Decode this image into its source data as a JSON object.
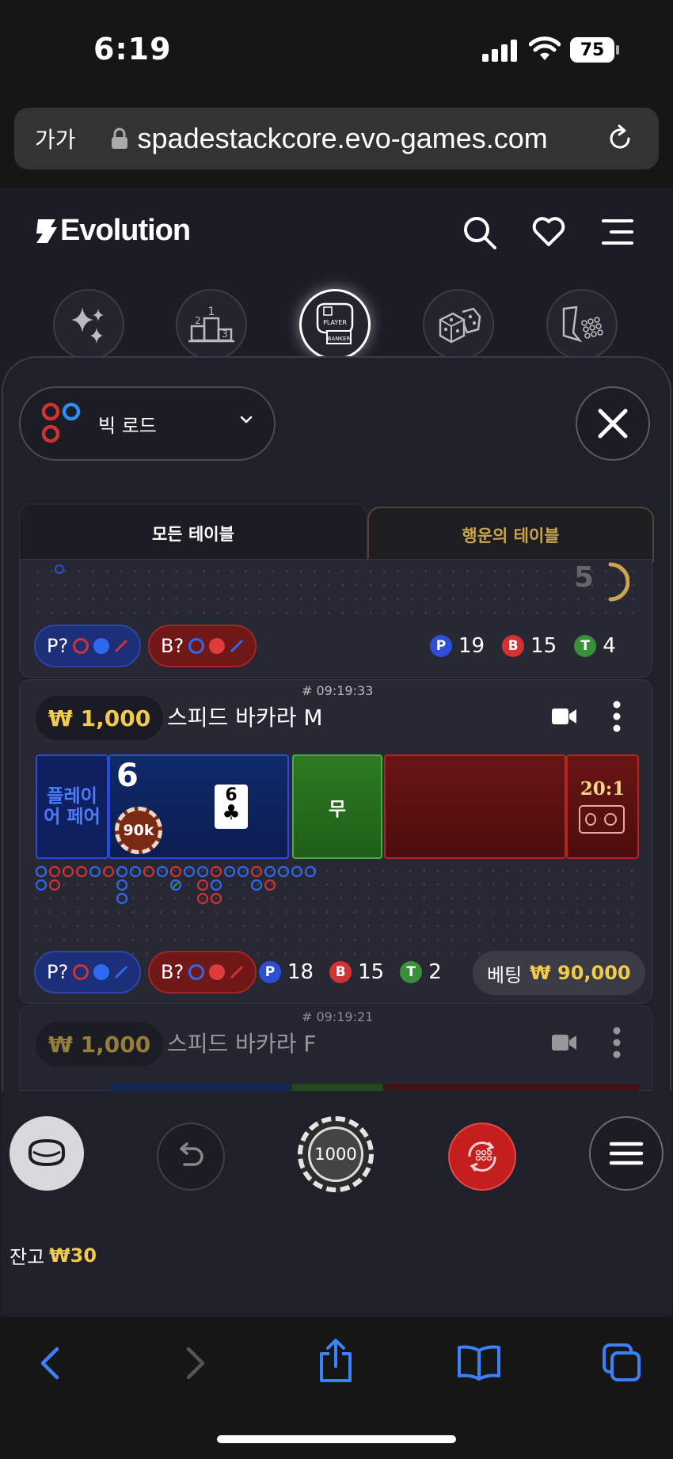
{
  "status_bar": {
    "time": "6:19",
    "battery": "75"
  },
  "browser": {
    "text_size_label": "가가",
    "url": "spadestackcore.evo-games.com"
  },
  "app": {
    "logo_text": "Evolution"
  },
  "categories": [
    {
      "icon": "sparkles-icon"
    },
    {
      "icon": "podium-icon",
      "podium": [
        "1",
        "2",
        "3"
      ]
    },
    {
      "icon": "baccarat-icon",
      "labels": [
        "PLAYER",
        "BANKER"
      ],
      "active": true
    },
    {
      "icon": "dice-icon"
    },
    {
      "icon": "roulette-icon"
    }
  ],
  "road_select": {
    "label": "빅 로드"
  },
  "tabs": {
    "all": "모든 테이블",
    "lucky": "행운의 테이블"
  },
  "prev_card": {
    "count": "5",
    "player_pair": "P?",
    "banker_pair": "B?",
    "stats": {
      "p_label": "P",
      "p": "19",
      "b_label": "B",
      "b": "15",
      "t_label": "T",
      "t": "4"
    }
  },
  "table_m": {
    "id": "# 09:19:33",
    "min_bet": "₩ 1,000",
    "name": "스피드 바카라 M",
    "player_pair_label": "플레이어 페어",
    "player_score": "6",
    "player_chip": "90k",
    "card": {
      "rank": "6",
      "suit": "♣"
    },
    "tie_label": "무",
    "banker_pair_odds": "20:1",
    "player_pair": "P?",
    "banker_pair": "B?",
    "stats": {
      "p_label": "P",
      "p": "18",
      "b_label": "B",
      "b": "15",
      "t_label": "T",
      "t": "2"
    },
    "bet_label": "베팅",
    "bet_value": "₩ 90,000"
  },
  "table_f": {
    "id": "# 09:19:21",
    "min_bet": "₩ 1,000",
    "name": "스피드 바카라 F"
  },
  "controls": {
    "chip_value": "1000"
  },
  "balance": {
    "label": "잔고",
    "value": "₩30"
  },
  "colors": {
    "player": "#2d4fd6",
    "banker": "#d33232",
    "tie": "#3a8f3a",
    "gold": "#f2c94c"
  }
}
